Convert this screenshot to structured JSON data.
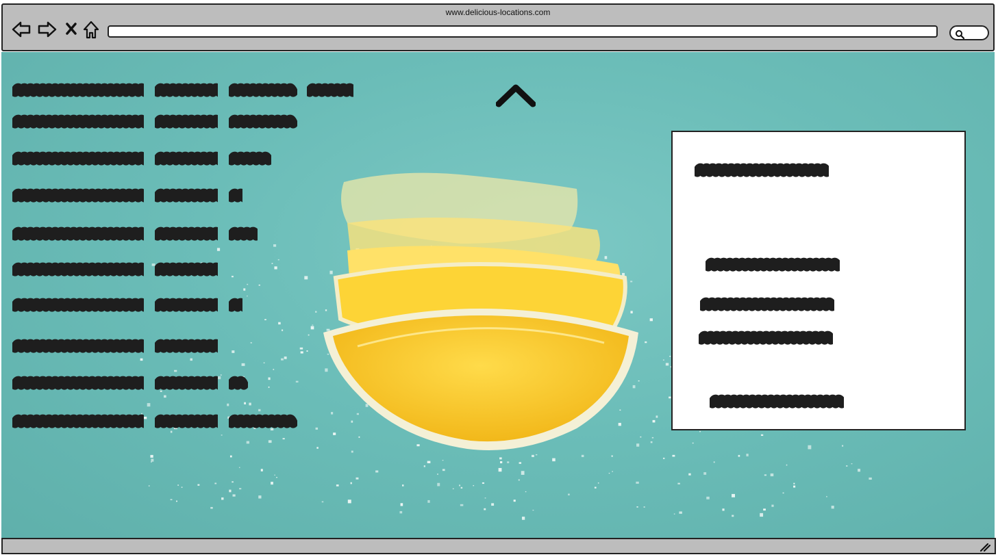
{
  "browser": {
    "url": "www.delicious-locations.com",
    "icons": [
      "back-arrow-icon",
      "forward-arrow-icon",
      "close-icon",
      "home-icon",
      "search-icon",
      "resize-grip-icon"
    ]
  },
  "content": {
    "background_color": "#6bbdb8",
    "image_subject": "lemon-slices",
    "left_list_lines": 10,
    "card_lines": 5,
    "scroll_up_icon": "chevron-up-icon"
  },
  "colors": {
    "scribble": "#1e1e1e",
    "chrome": "#bdbdbd",
    "lemon": "#f7c623"
  }
}
